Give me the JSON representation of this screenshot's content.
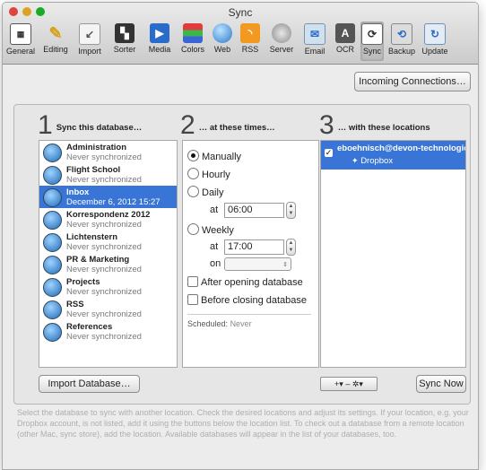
{
  "window": {
    "title": "Sync"
  },
  "traffic_lights": [
    {
      "name": "close",
      "color": "#e0443e"
    },
    {
      "name": "minimize",
      "color": "#dea123"
    },
    {
      "name": "zoom",
      "color": "#1aab29"
    }
  ],
  "toolbar": {
    "items": [
      {
        "label": "General",
        "icon": "general-icon"
      },
      {
        "label": "Editing",
        "icon": "pencil-icon"
      },
      {
        "label": "Import",
        "icon": "import-icon"
      },
      {
        "label": "Sorter",
        "icon": "sorter-icon"
      },
      {
        "label": "Media",
        "icon": "media-icon"
      },
      {
        "label": "Colors",
        "icon": "colors-icon"
      },
      {
        "label": "Web",
        "icon": "globe-icon"
      },
      {
        "label": "RSS",
        "icon": "rss-icon"
      },
      {
        "label": "Server",
        "icon": "server-icon"
      },
      {
        "label": "Email",
        "icon": "email-icon"
      },
      {
        "label": "OCR",
        "icon": "ocr-icon"
      },
      {
        "label": "Sync",
        "icon": "sync-icon"
      },
      {
        "label": "Backup",
        "icon": "backup-icon"
      },
      {
        "label": "Update",
        "icon": "update-icon"
      }
    ],
    "selected": "Sync"
  },
  "incoming_button": "Incoming Connections…",
  "columns": {
    "c1": {
      "num": "1",
      "label": "Sync this database…"
    },
    "c2": {
      "num": "2",
      "label": "… at these times…"
    },
    "c3": {
      "num": "3",
      "label": "… with these locations"
    }
  },
  "databases": [
    {
      "name": "Administration",
      "status": "Never synchronized"
    },
    {
      "name": "Flight School",
      "status": "Never synchronized"
    },
    {
      "name": "Inbox",
      "status": "December 6, 2012 15:27"
    },
    {
      "name": "Korrespondenz 2012",
      "status": "Never synchronized"
    },
    {
      "name": "Lichtenstern",
      "status": "Never synchronized"
    },
    {
      "name": "PR & Marketing",
      "status": "Never synchronized"
    },
    {
      "name": "Projects",
      "status": "Never synchronized"
    },
    {
      "name": "RSS",
      "status": "Never synchronized"
    },
    {
      "name": "References",
      "status": "Never synchronized"
    }
  ],
  "selected_database": "Inbox",
  "schedule": {
    "manually": "Manually",
    "hourly": "Hourly",
    "daily": "Daily",
    "daily_at_label": "at",
    "daily_time": "06:00",
    "weekly": "Weekly",
    "weekly_at_label": "at",
    "weekly_time": "17:00",
    "weekly_on_label": "on",
    "weekly_day": "",
    "after_opening": "After opening database",
    "before_closing": "Before closing database",
    "selected": "Manually",
    "scheduled_label": "Scheduled:",
    "scheduled_value": "Never"
  },
  "locations": [
    {
      "name": "eboehnisch@devon-technologies",
      "service": "Dropbox",
      "checked": true
    }
  ],
  "buttons": {
    "import_database": "Import Database…",
    "add": "+",
    "add_arrow": "▾",
    "remove": "–",
    "gear": "✲",
    "gear_arrow": "▾",
    "sync_now": "Sync Now"
  },
  "help_text": "Select the database to sync with another location. Check the desired locations and adjust its settings. If your location, e.g. your Dropbox account, is not listed, add it using the buttons below the location list. To check out a database from a remote location (other Mac, sync store), add the location. Available databases will appear in the list of your databases, too.",
  "colors": {
    "selection": "#3875d7",
    "accent_blue": "#2a6cc9"
  }
}
